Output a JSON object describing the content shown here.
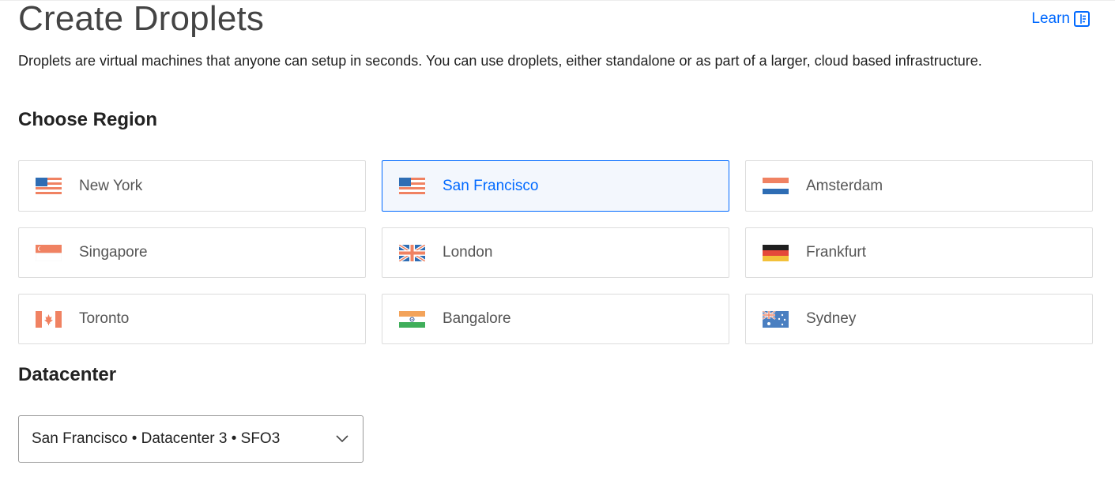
{
  "page": {
    "title": "Create Droplets",
    "learn_label": "Learn",
    "subtitle": "Droplets are virtual machines that anyone can setup in seconds. You can use droplets, either standalone or as part of a larger, cloud based infrastructure."
  },
  "region_section": {
    "title": "Choose Region",
    "regions": [
      {
        "label": "New York",
        "flag": "us-flag-icon"
      },
      {
        "label": "San Francisco",
        "flag": "us-flag-icon",
        "selected": true
      },
      {
        "label": "Amsterdam",
        "flag": "netherlands-flag-icon"
      },
      {
        "label": "Singapore",
        "flag": "singapore-flag-icon"
      },
      {
        "label": "London",
        "flag": "uk-flag-icon"
      },
      {
        "label": "Frankfurt",
        "flag": "germany-flag-icon"
      },
      {
        "label": "Toronto",
        "flag": "canada-flag-icon"
      },
      {
        "label": "Bangalore",
        "flag": "india-flag-icon"
      },
      {
        "label": "Sydney",
        "flag": "australia-flag-icon"
      }
    ]
  },
  "datacenter_section": {
    "title": "Datacenter",
    "selected_value": "San Francisco • Datacenter 3 • SFO3"
  },
  "colors": {
    "accent": "#0069ff",
    "selected_bg": "#f3f7fd",
    "border": "#dcdcdc"
  }
}
